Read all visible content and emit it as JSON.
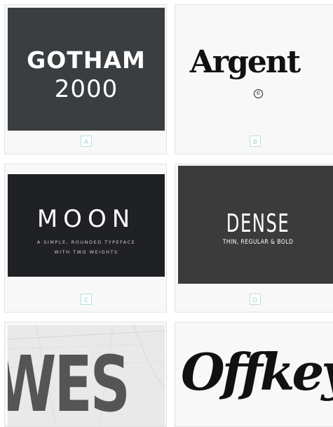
{
  "cards": [
    {
      "id": "a",
      "badge": "A",
      "lines": [
        "GOTHAM",
        "2000"
      ],
      "bg": "#3a3e41",
      "text_color": "#ffffff"
    },
    {
      "id": "b",
      "badge": "B",
      "lines": [
        "Argent",
        "©"
      ],
      "bg": "#f8f8f8",
      "text_color": "#111111"
    },
    {
      "id": "c",
      "badge": "C",
      "lines": [
        "MOON",
        "A SIMPLE, ROUNDED TYPEFACE",
        "WITH TWO WEIGHTS"
      ],
      "bg": "#202124",
      "text_color": "#ffffff"
    },
    {
      "id": "d",
      "badge": "D",
      "lines": [
        "DENSE",
        "THIN, REGULAR & BOLD"
      ],
      "bg": "#3b3b3b",
      "text_color": "#ffffff"
    },
    {
      "id": "e",
      "badge": "",
      "lines": [
        "WES"
      ],
      "bg": "#e9e9e9",
      "text_color": "#555555"
    },
    {
      "id": "f",
      "badge": "",
      "lines": [
        "Offkey"
      ],
      "bg": "#f8f8f8",
      "text_color": "#111111"
    }
  ],
  "accent_badge_color": "#9fcfd1"
}
